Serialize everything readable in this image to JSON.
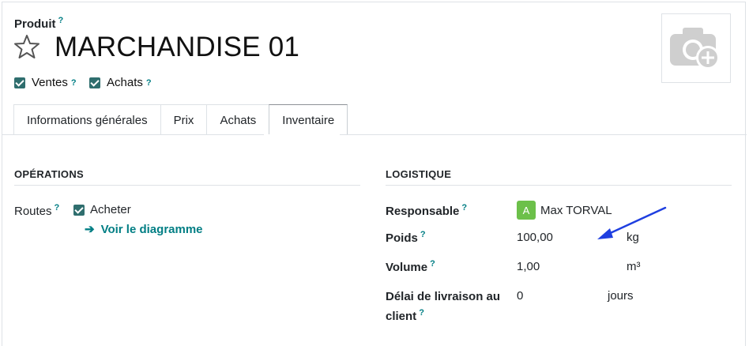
{
  "product": {
    "label": "Produit",
    "help": "?",
    "name": "MARCHANDISE 01",
    "favorite_icon": "star-icon",
    "photo_icon": "camera-add-icon"
  },
  "flags": [
    {
      "label": "Ventes",
      "help": "?",
      "checked": true
    },
    {
      "label": "Achats",
      "help": "?",
      "checked": true
    }
  ],
  "tabs": [
    {
      "label": "Informations générales"
    },
    {
      "label": "Prix"
    },
    {
      "label": "Achats"
    },
    {
      "label": "Inventaire",
      "active": true
    }
  ],
  "operations": {
    "title": "OPÉRATIONS",
    "routes_label": "Routes",
    "routes_help": "?",
    "route_option": "Acheter",
    "route_checked": true,
    "diagram_link": "Voir le diagramme"
  },
  "logistique": {
    "title": "LOGISTIQUE",
    "responsable_label": "Responsable",
    "responsable_help": "?",
    "responsable_initial": "A",
    "responsable_name": "Max TORVAL",
    "poids_label": "Poids",
    "poids_help": "?",
    "poids_value": "100,00",
    "poids_unit": "kg",
    "volume_label": "Volume",
    "volume_help": "?",
    "volume_value": "1,00",
    "volume_unit": "m³",
    "delai_label_line1": "Délai de livraison au",
    "delai_label_line2": "client",
    "delai_help": "?",
    "delai_value": "0",
    "delai_unit": "jours"
  },
  "colors": {
    "accent": "#017e84",
    "checkbox": "#2f6e6e",
    "avatar": "#6cc04a",
    "annotation_arrow": "#1f3fe0"
  }
}
